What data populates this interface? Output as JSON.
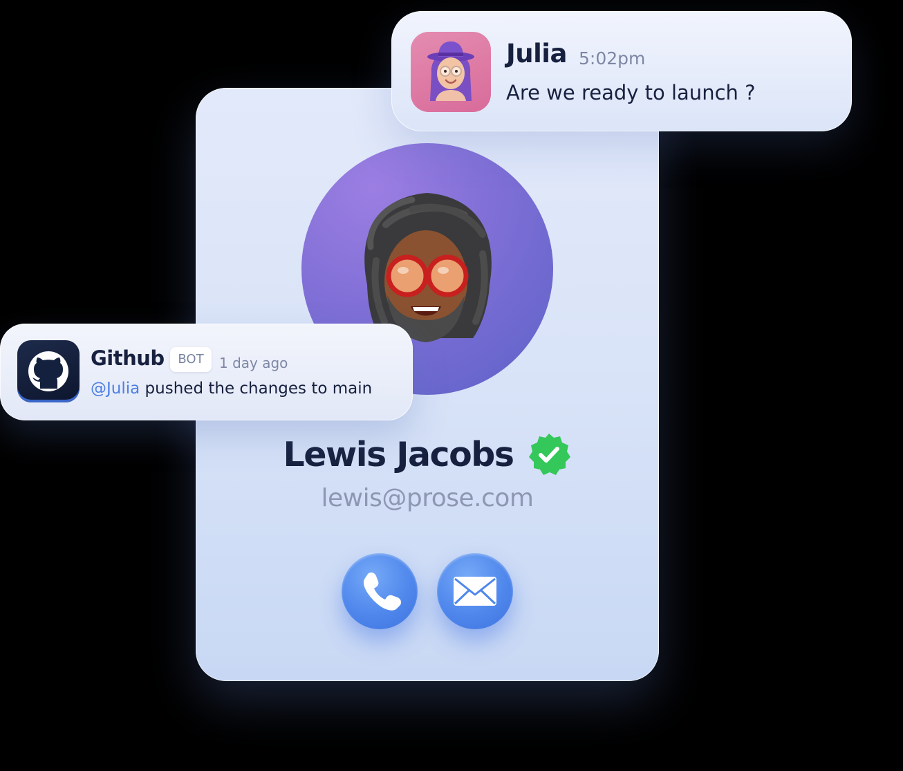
{
  "profile": {
    "name": "Lewis Jacobs",
    "email": "lewis@prose.com",
    "verified": true,
    "avatar_icon": "memoji-avatar-icon",
    "actions": [
      {
        "icon": "phone-icon"
      },
      {
        "icon": "mail-icon"
      }
    ]
  },
  "notifications": {
    "julia": {
      "sender": "Julia",
      "time": "5:02pm",
      "message": "Are we ready to launch ?",
      "avatar_icon": "memoji-avatar-icon"
    },
    "github": {
      "sender": "Github",
      "badge": "BOT",
      "time": "1 day ago",
      "mention": "@Julia",
      "message": " pushed the changes to main",
      "avatar_icon": "github-icon"
    }
  },
  "colors": {
    "accent": "#4f87ec",
    "verified": "#34c759",
    "mention": "#4c7fe3",
    "text_primary": "#17213f",
    "text_secondary": "#8e97b2"
  }
}
